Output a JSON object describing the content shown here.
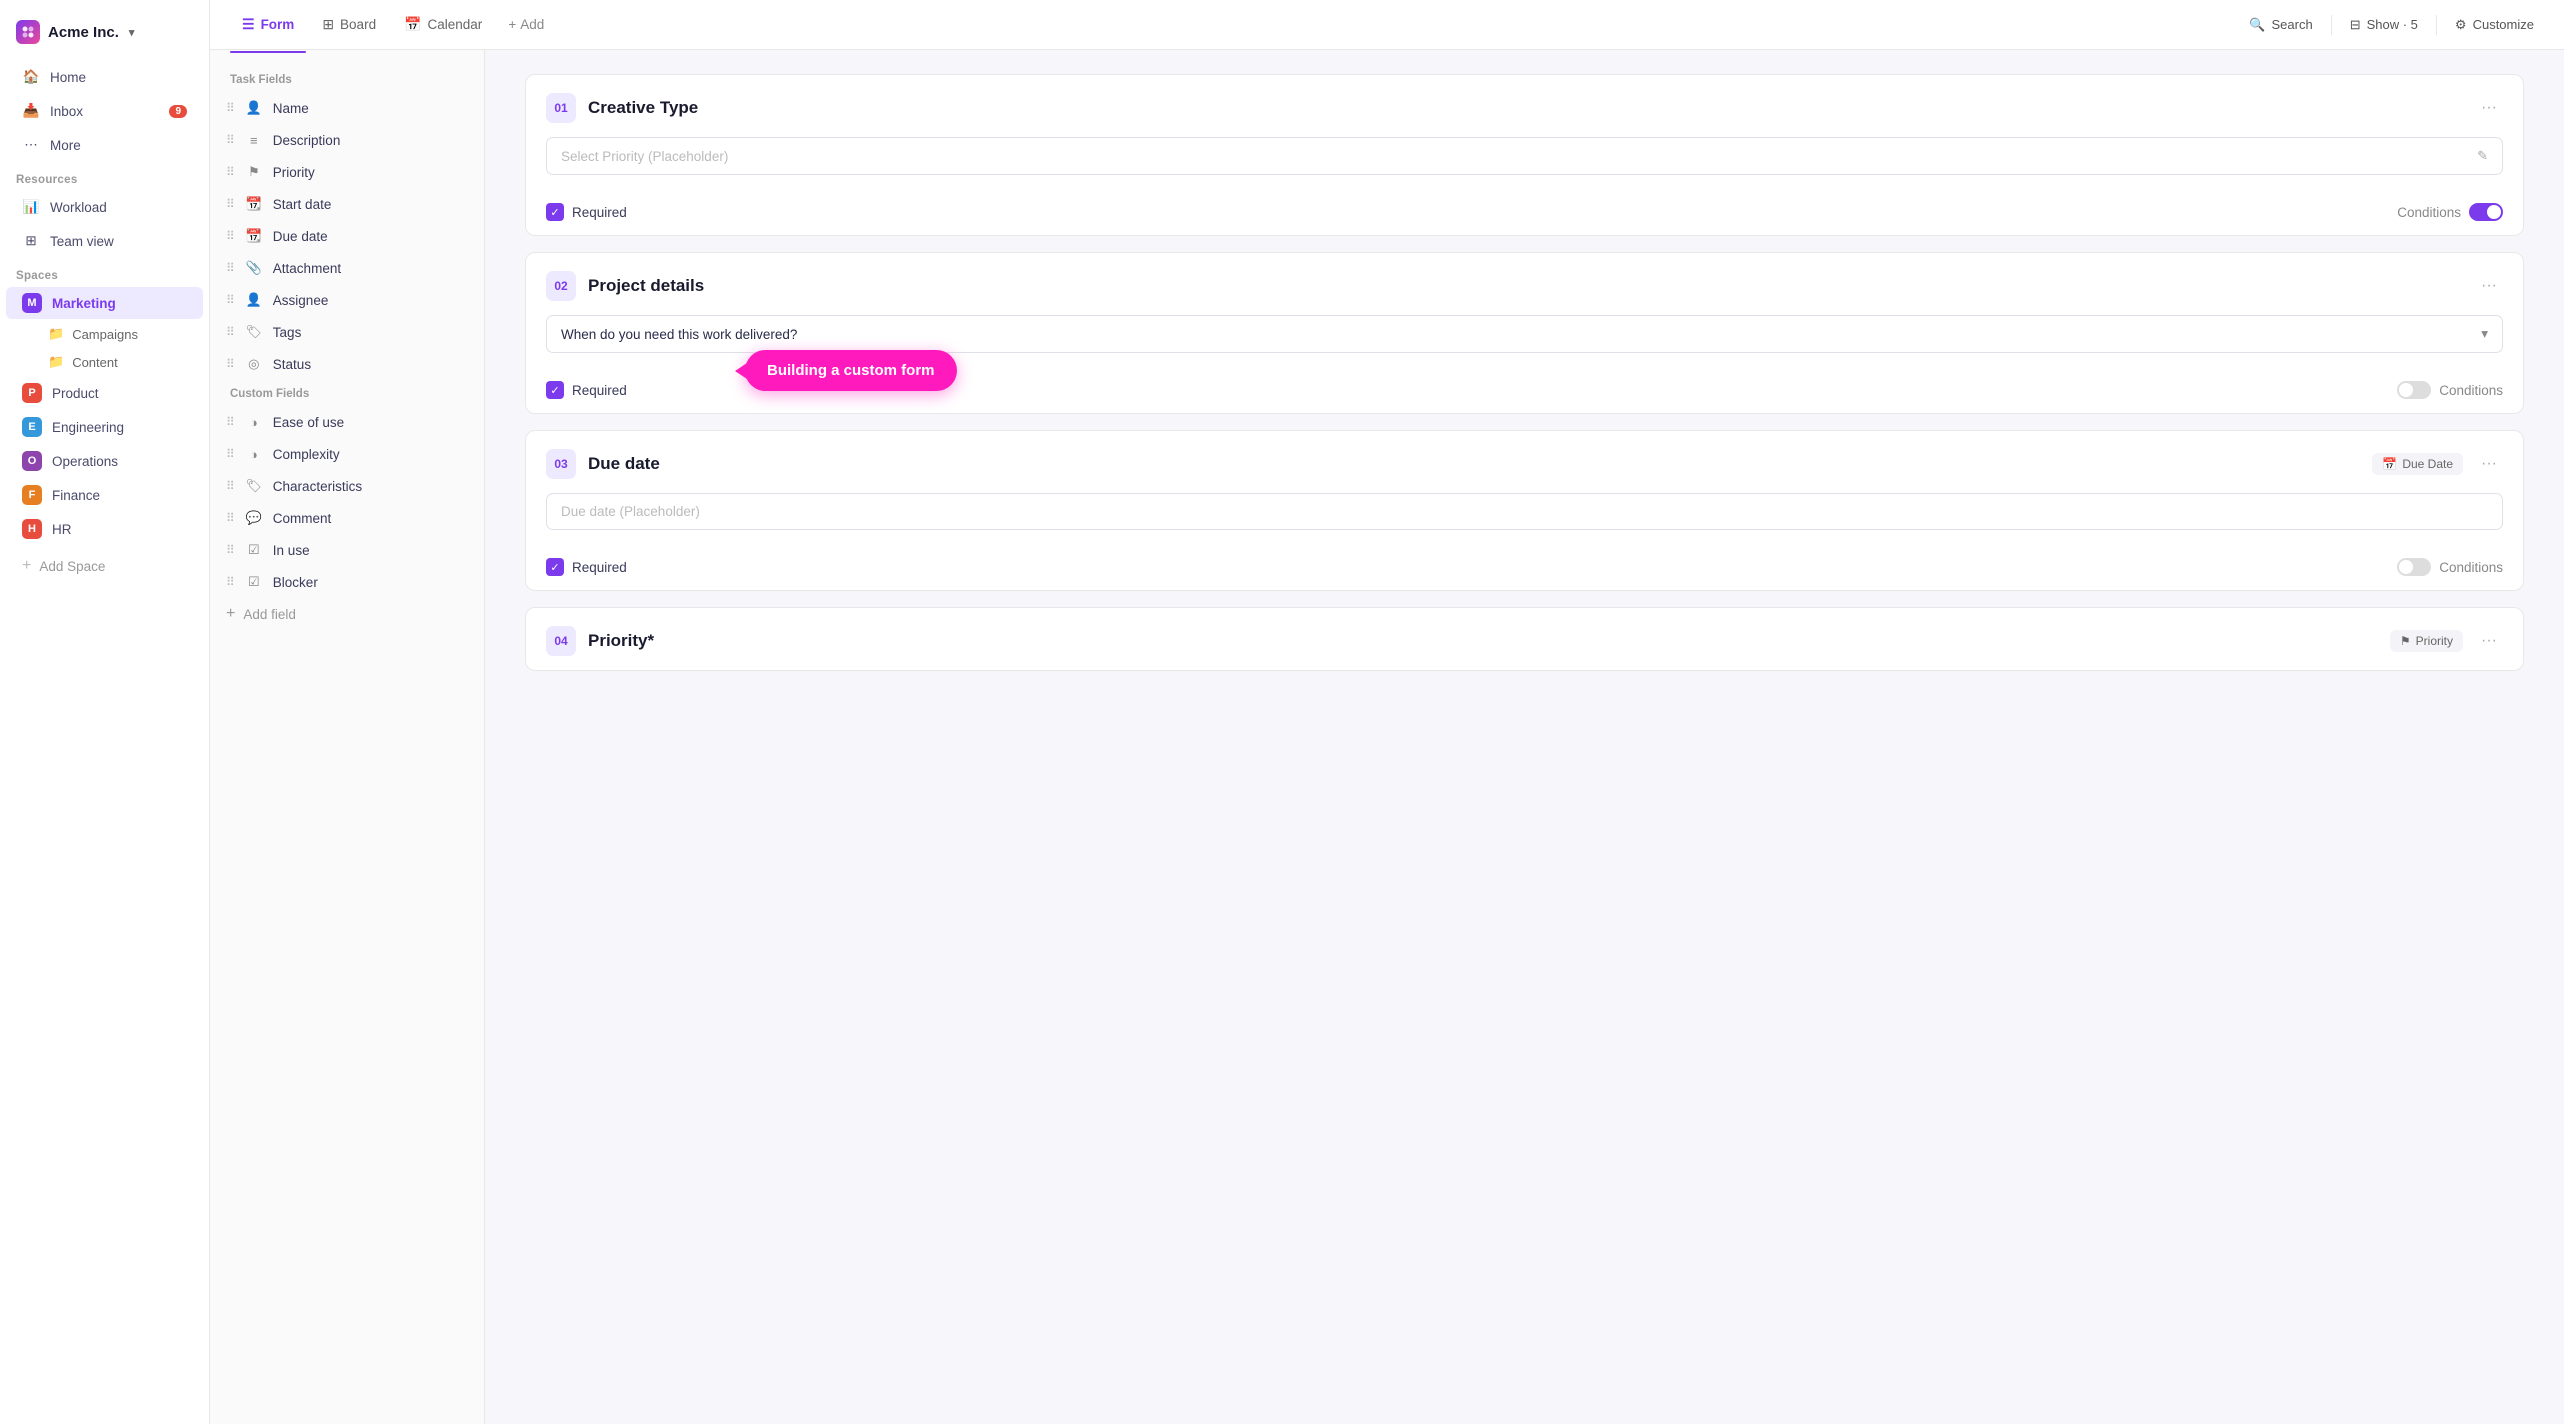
{
  "app": {
    "name": "Acme Inc.",
    "logo_alt": "Acme logo"
  },
  "sidebar": {
    "nav_items": [
      {
        "id": "home",
        "label": "Home",
        "icon": "home"
      },
      {
        "id": "inbox",
        "label": "Inbox",
        "icon": "inbox",
        "badge": "9"
      },
      {
        "id": "more",
        "label": "More",
        "icon": "more"
      }
    ],
    "resources_label": "Resources",
    "resource_items": [
      {
        "id": "workload",
        "label": "Workload",
        "icon": "workload"
      },
      {
        "id": "team-view",
        "label": "Team view",
        "icon": "team"
      }
    ],
    "spaces_label": "Spaces",
    "spaces": [
      {
        "id": "marketing",
        "label": "Marketing",
        "color": "#7c3aed",
        "letter": "M",
        "active": true
      },
      {
        "id": "product",
        "label": "Product",
        "color": "#e74c3c",
        "letter": "P",
        "active": false
      },
      {
        "id": "engineering",
        "label": "Engineering",
        "color": "#3498db",
        "letter": "E",
        "active": false
      },
      {
        "id": "operations",
        "label": "Operations",
        "color": "#8e44ad",
        "letter": "O",
        "active": false
      },
      {
        "id": "finance",
        "label": "Finance",
        "color": "#e67e22",
        "letter": "F",
        "active": false
      },
      {
        "id": "hr",
        "label": "HR",
        "color": "#e74c3c",
        "letter": "H",
        "active": false
      }
    ],
    "marketing_sub": [
      {
        "id": "campaigns",
        "label": "Campaigns"
      },
      {
        "id": "content",
        "label": "Content"
      }
    ],
    "add_space_label": "Add Space"
  },
  "topnav": {
    "tabs": [
      {
        "id": "form",
        "label": "Form",
        "icon": "form",
        "active": true
      },
      {
        "id": "board",
        "label": "Board",
        "icon": "board",
        "active": false
      },
      {
        "id": "calendar",
        "label": "Calendar",
        "icon": "calendar",
        "active": false
      }
    ],
    "add_label": "Add",
    "actions": [
      {
        "id": "search",
        "label": "Search",
        "icon": "search"
      },
      {
        "id": "show",
        "label": "Show · 5",
        "icon": "show"
      },
      {
        "id": "customize",
        "label": "Customize",
        "icon": "customize"
      }
    ]
  },
  "fields_panel": {
    "task_fields_label": "Task Fields",
    "task_fields": [
      {
        "id": "name",
        "label": "Name",
        "icon": "person"
      },
      {
        "id": "description",
        "label": "Description",
        "icon": "align-left"
      },
      {
        "id": "priority",
        "label": "Priority",
        "icon": "flag"
      },
      {
        "id": "start-date",
        "label": "Start date",
        "icon": "calendar"
      },
      {
        "id": "due-date",
        "label": "Due date",
        "icon": "calendar"
      },
      {
        "id": "attachment",
        "label": "Attachment",
        "icon": "paperclip"
      },
      {
        "id": "assignee",
        "label": "Assignee",
        "icon": "person"
      },
      {
        "id": "tags",
        "label": "Tags",
        "icon": "tag"
      },
      {
        "id": "status",
        "label": "Status",
        "icon": "circle"
      }
    ],
    "custom_fields_label": "Custom Fields",
    "custom_fields": [
      {
        "id": "ease-of-use",
        "label": "Ease of use",
        "icon": "gauge"
      },
      {
        "id": "complexity",
        "label": "Complexity",
        "icon": "gauge"
      },
      {
        "id": "characteristics",
        "label": "Characteristics",
        "icon": "tag"
      },
      {
        "id": "comment",
        "label": "Comment",
        "icon": "comment"
      },
      {
        "id": "in-use",
        "label": "In use",
        "icon": "checkbox"
      },
      {
        "id": "blocker",
        "label": "Blocker",
        "icon": "checkbox"
      }
    ],
    "add_field_label": "Add field"
  },
  "form_cards": [
    {
      "id": "card-1",
      "number": "01",
      "title": "Creative Type",
      "badge": null,
      "input_type": "text",
      "placeholder": "Select Priority (Placeholder)",
      "show_edit_icon": true,
      "required": true,
      "conditions_on": true
    },
    {
      "id": "card-2",
      "number": "02",
      "title": "Project details",
      "badge": null,
      "input_type": "select",
      "placeholder": "When do you need this work delivered?",
      "show_chevron": true,
      "required": true,
      "conditions_on": false
    },
    {
      "id": "card-3",
      "number": "03",
      "title": "Due date",
      "badge": "Due Date",
      "badge_icon": "calendar",
      "input_type": "text",
      "placeholder": "Due date (Placeholder)",
      "required": true,
      "conditions_on": false
    },
    {
      "id": "card-4",
      "number": "04",
      "title": "Priority*",
      "badge": "Priority",
      "badge_icon": "flag",
      "input_type": "none",
      "placeholder": "",
      "required": false,
      "conditions_on": false,
      "partial": true
    }
  ],
  "tooltip": {
    "text": "Building a custom form"
  },
  "labels": {
    "required": "Required",
    "conditions": "Conditions"
  }
}
